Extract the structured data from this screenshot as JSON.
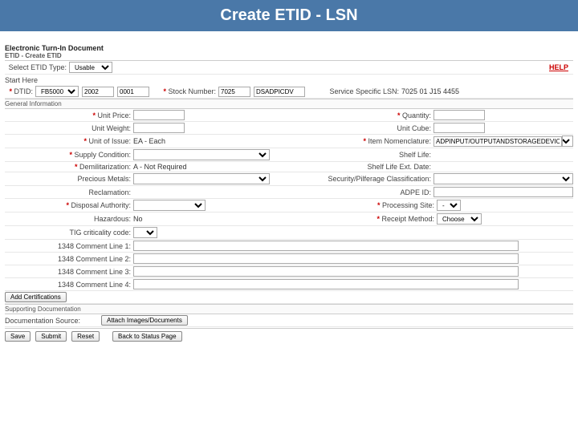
{
  "slide": {
    "title": "Create ETID - LSN"
  },
  "header": {
    "line1": "Electronic Turn-In Document",
    "line2": "ETID - Create ETID"
  },
  "help": "HELP",
  "topbar": {
    "select_type_label": "Select ETID Type:",
    "select_type_value": "Usable",
    "start_here": "Start Here"
  },
  "dtid": {
    "label": "DTID:",
    "p1": "FB5000",
    "p2": "2002",
    "p3": "0001"
  },
  "stock": {
    "label": "Stock Number:",
    "v1": "7025",
    "v2": "DSADPICDV"
  },
  "ssl": {
    "label": "Service Specific LSN:",
    "value": "7025 01 J15 4455"
  },
  "sections": {
    "general": "General Information",
    "supporting": "Supporting Documentation"
  },
  "fields": {
    "unit_price": "Unit Price:",
    "quantity": "Quantity:",
    "unit_weight": "Unit Weight:",
    "unit_cube": "Unit Cube:",
    "unit_issue": "Unit of Issue:",
    "unit_issue_val": "EA - Each",
    "item_nomen": "Item Nomenclature:",
    "item_nomen_val": "ADPINPUT/OUTPUTANDSTORAGEDEVICES",
    "supply_cond": "Supply Condition:",
    "shelf_life": "Shelf Life:",
    "demil": "Demilitarization:",
    "demil_val": "A - Not Required",
    "shelf_life_ext": "Shelf Life Ext. Date:",
    "precious": "Precious Metals:",
    "security": "Security/Pilferage Classification:",
    "reclamation": "Reclamation:",
    "adpe_id": "ADPE ID:",
    "disposal": "Disposal Authority:",
    "processing": "Processing Site:",
    "hazardous": "Hazardous:",
    "hazardous_val": "No",
    "receipt": "Receipt Method:",
    "receipt_val": "Choose",
    "tig": "TIG criticality code:",
    "c1": "1348 Comment Line 1:",
    "c2": "1348 Comment Line 2:",
    "c3": "1348 Comment Line 3:",
    "c4": "1348 Comment Line 4:"
  },
  "buttons": {
    "add_cert": "Add Certifications",
    "doc_source": "Documentation Source:",
    "attach": "Attach Images/Documents",
    "save": "Save",
    "submit": "Submit",
    "reset": "Reset",
    "back": "Back to Status Page"
  }
}
